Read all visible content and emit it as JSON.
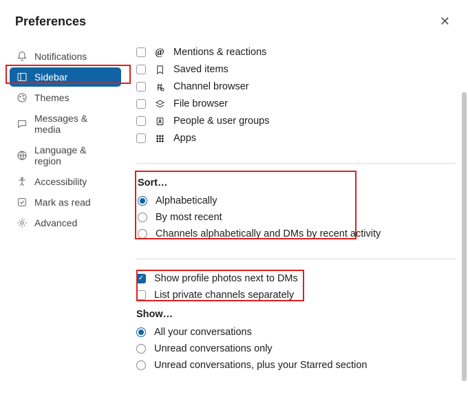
{
  "header": {
    "title": "Preferences"
  },
  "nav": {
    "items": [
      {
        "id": "notifications",
        "label": "Notifications",
        "icon": "bell-icon",
        "active": false
      },
      {
        "id": "sidebar",
        "label": "Sidebar",
        "icon": "sidebar-icon",
        "active": true
      },
      {
        "id": "themes",
        "label": "Themes",
        "icon": "palette-icon",
        "active": false
      },
      {
        "id": "messages",
        "label": "Messages & media",
        "icon": "message-icon",
        "active": false
      },
      {
        "id": "language",
        "label": "Language & region",
        "icon": "globe-icon",
        "active": false
      },
      {
        "id": "accessibility",
        "label": "Accessibility",
        "icon": "accessibility-icon",
        "active": false
      },
      {
        "id": "mark",
        "label": "Mark as read",
        "icon": "check-icon",
        "active": false
      },
      {
        "id": "advanced",
        "label": "Advanced",
        "icon": "gear-icon",
        "active": false
      }
    ]
  },
  "show_in_sidebar": {
    "items": [
      {
        "id": "mentions",
        "label": "Mentions & reactions",
        "icon": "at-icon",
        "checked": false
      },
      {
        "id": "saved",
        "label": "Saved items",
        "icon": "bookmark-icon",
        "checked": false
      },
      {
        "id": "channel_browser",
        "label": "Channel browser",
        "icon": "hash-search-icon",
        "checked": false
      },
      {
        "id": "file_browser",
        "label": "File browser",
        "icon": "file-stack-icon",
        "checked": false
      },
      {
        "id": "people",
        "label": "People & user groups",
        "icon": "people-icon",
        "checked": false
      },
      {
        "id": "apps",
        "label": "Apps",
        "icon": "apps-grid-icon",
        "checked": false
      }
    ]
  },
  "sort": {
    "heading": "Sort…",
    "options": [
      {
        "id": "alpha",
        "label": "Alphabetically",
        "selected": true
      },
      {
        "id": "recent",
        "label": "By most recent",
        "selected": false
      },
      {
        "id": "mixed",
        "label": "Channels alphabetically and DMs by recent activity",
        "selected": false
      }
    ]
  },
  "dm": {
    "items": [
      {
        "id": "profile_photos",
        "label": "Show profile photos next to DMs",
        "checked": true
      },
      {
        "id": "private_separate",
        "label": "List private channels separately",
        "checked": false
      }
    ]
  },
  "show": {
    "heading": "Show…",
    "options": [
      {
        "id": "all",
        "label": "All your conversations",
        "selected": true
      },
      {
        "id": "unread",
        "label": "Unread conversations only",
        "selected": false
      },
      {
        "id": "starred",
        "label": "Unread conversations, plus your Starred section",
        "selected": false
      }
    ]
  }
}
